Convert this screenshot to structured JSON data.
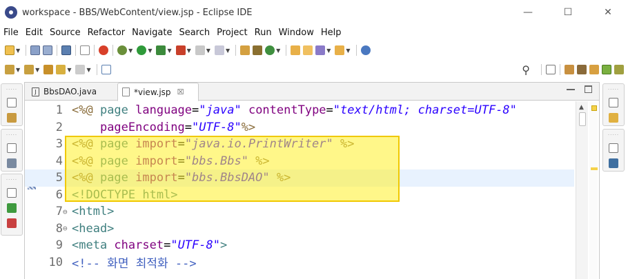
{
  "window": {
    "title": "workspace - BBS/WebContent/view.jsp - Eclipse IDE",
    "controls": {
      "minimize": "—",
      "maximize": "☐",
      "close": "✕"
    }
  },
  "menu": [
    "File",
    "Edit",
    "Source",
    "Refactor",
    "Navigate",
    "Search",
    "Project",
    "Run",
    "Window",
    "Help"
  ],
  "toolbar_icons": {
    "row1": [
      "new-icon",
      "save-icon",
      "save-all-icon",
      "console-icon",
      "skip-icon",
      "error-icon",
      "debug-icon",
      "run-icon",
      "server-icon",
      "server-stop-icon",
      "coverage-icon",
      "external-tools-icon",
      "search-icon",
      "folder-icon",
      "open-type-icon",
      "annotation-icon",
      "web-browser-icon"
    ],
    "row2": [
      "next-annotation-icon",
      "prev-annotation-icon",
      "back-icon",
      "forward-icon",
      "pin-icon"
    ],
    "perspectives": [
      "java-ee-perspective-icon",
      "debug-perspective-icon",
      "git-perspective-icon",
      "java-perspective-icon",
      "other-perspective-icon"
    ]
  },
  "editor": {
    "tabs": [
      {
        "label": "BbsDAO.java",
        "icon": "java-file-icon",
        "active": false
      },
      {
        "label": "*view.jsp",
        "icon": "jsp-file-icon",
        "active": true,
        "close": "☒"
      }
    ],
    "lines": [
      {
        "num": "1",
        "fold": "",
        "segments": [
          {
            "t": "<%@ ",
            "c": "c-delim"
          },
          {
            "t": "page ",
            "c": "c-kw"
          },
          {
            "t": "language",
            "c": "c-attr"
          },
          {
            "t": "=",
            "c": "c-eq"
          },
          {
            "t": "\"java\"",
            "c": "c-str"
          },
          {
            "t": " ",
            "c": "c-plain"
          },
          {
            "t": "contentType",
            "c": "c-attr"
          },
          {
            "t": "=",
            "c": "c-eq"
          },
          {
            "t": "\"text/html; charset=UTF-8\"",
            "c": "c-str"
          }
        ]
      },
      {
        "num": "2",
        "fold": "",
        "segments": [
          {
            "t": "    ",
            "c": "c-plain"
          },
          {
            "t": "pageEncoding",
            "c": "c-attr"
          },
          {
            "t": "=",
            "c": "c-eq"
          },
          {
            "t": "\"UTF-8\"",
            "c": "c-str"
          },
          {
            "t": "%>",
            "c": "c-delim"
          }
        ]
      },
      {
        "num": "3",
        "fold": "",
        "segments": [
          {
            "t": "<%@ ",
            "c": "c-delim"
          },
          {
            "t": "page ",
            "c": "c-kw"
          },
          {
            "t": "import",
            "c": "c-attr"
          },
          {
            "t": "=",
            "c": "c-eq"
          },
          {
            "t": "\"java.io.PrintWriter\"",
            "c": "c-str"
          },
          {
            "t": " %>",
            "c": "c-delim"
          }
        ]
      },
      {
        "num": "4",
        "fold": "",
        "segments": [
          {
            "t": "<%@ ",
            "c": "c-delim"
          },
          {
            "t": "page ",
            "c": "c-kw"
          },
          {
            "t": "import",
            "c": "c-attr"
          },
          {
            "t": "=",
            "c": "c-eq"
          },
          {
            "t": "\"bbs.Bbs\"",
            "c": "c-str"
          },
          {
            "t": " %>",
            "c": "c-delim"
          }
        ]
      },
      {
        "num": "5",
        "fold": "",
        "current": true,
        "segments": [
          {
            "t": "<%@ ",
            "c": "c-delim"
          },
          {
            "t": "page ",
            "c": "c-kw"
          },
          {
            "t": "import",
            "c": "c-attr"
          },
          {
            "t": "=",
            "c": "c-eq"
          },
          {
            "t": "\"bbs.BbsDAO\"",
            "c": "c-str"
          },
          {
            "t": " %>",
            "c": "c-delim"
          }
        ]
      },
      {
        "num": "6",
        "fold": "",
        "segments": [
          {
            "t": "<!DOCTYPE html>",
            "c": "c-tag"
          }
        ]
      },
      {
        "num": "7",
        "fold": "⊖",
        "segments": [
          {
            "t": "<html>",
            "c": "c-tag"
          }
        ]
      },
      {
        "num": "8",
        "fold": "⊖",
        "segments": [
          {
            "t": "<head>",
            "c": "c-tag"
          }
        ]
      },
      {
        "num": "9",
        "fold": "",
        "segments": [
          {
            "t": "<meta ",
            "c": "c-tag"
          },
          {
            "t": "charset",
            "c": "c-attr"
          },
          {
            "t": "=",
            "c": "c-eq"
          },
          {
            "t": "\"UTF-8\"",
            "c": "c-str"
          },
          {
            "t": ">",
            "c": "c-tag"
          }
        ]
      },
      {
        "num": "10",
        "fold": "",
        "segments": [
          {
            "t": "<!-- 화면 최적화 -->",
            "c": "c-comment"
          }
        ]
      }
    ]
  },
  "colors": {
    "highlight": "#fff028",
    "highlight_border": "#f0c800",
    "current_line": "#e8f2fe"
  }
}
